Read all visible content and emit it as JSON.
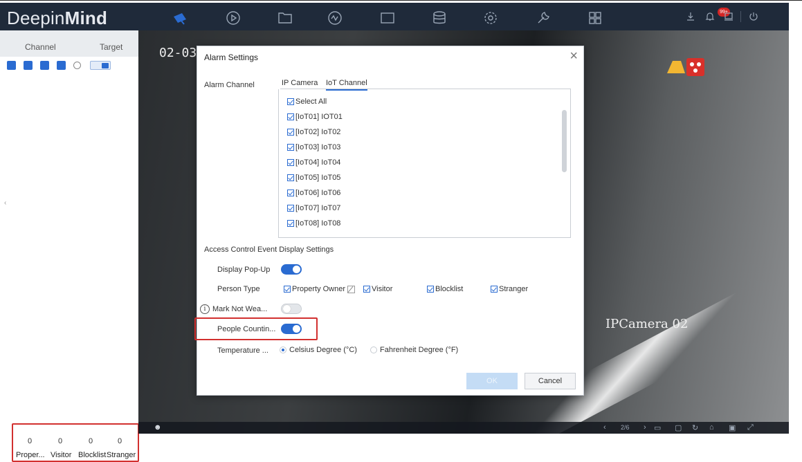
{
  "app": {
    "brand_light": "Deepin",
    "brand_bold": "Mind"
  },
  "topbar": {
    "icons": [
      "camera-icon",
      "playback-icon",
      "file-icon",
      "analysis-icon",
      "screen-icon",
      "storage-icon",
      "settings-icon",
      "maintenance-icon",
      "apps-icon"
    ],
    "notification_badge": "99+",
    "accent": "#2a6bd1"
  },
  "sidebar": {
    "tabs": [
      "Channel",
      "Target"
    ],
    "counts": [
      {
        "value": "0",
        "label": "Proper..."
      },
      {
        "value": "0",
        "label": "Visitor"
      },
      {
        "value": "0",
        "label": "Blocklist"
      },
      {
        "value": "0",
        "label": "Stranger"
      }
    ]
  },
  "video": {
    "timestamp": "02-03",
    "camera_name": "IPCamera 02",
    "page_indicator": "2/6"
  },
  "dialog": {
    "title": "Alarm Settings",
    "alarm_channel_label": "Alarm Channel",
    "tabs": [
      "IP Camera",
      "IoT Channel"
    ],
    "select_all": "Select All",
    "channels": [
      "[IoT01] IOT01",
      "[IoT02] IoT02",
      "[IoT03] IoT03",
      "[IoT04] IoT04",
      "[IoT05] IoT05",
      "[IoT06] IoT06",
      "[IoT07] IoT07",
      "[IoT08] IoT08"
    ],
    "section_title": "Access Control Event Display Settings",
    "display_popup_label": "Display Pop-Up",
    "display_popup_on": true,
    "person_type_label": "Person Type",
    "person_types": [
      "Property Owner",
      "Visitor",
      "Blocklist",
      "Stranger"
    ],
    "mark_not_wear_label": "Mark Not Wea...",
    "mark_not_wear_on": false,
    "people_counting_label": "People Countin...",
    "people_counting_on": true,
    "temperature_label": "Temperature ...",
    "temp_options": [
      "Celsius Degree (°C)",
      "Fahrenheit Degree (°F)"
    ],
    "temp_selected": "Celsius Degree (°C)",
    "ok_label": "OK",
    "cancel_label": "Cancel",
    "highlight_color": "#d2302f"
  }
}
